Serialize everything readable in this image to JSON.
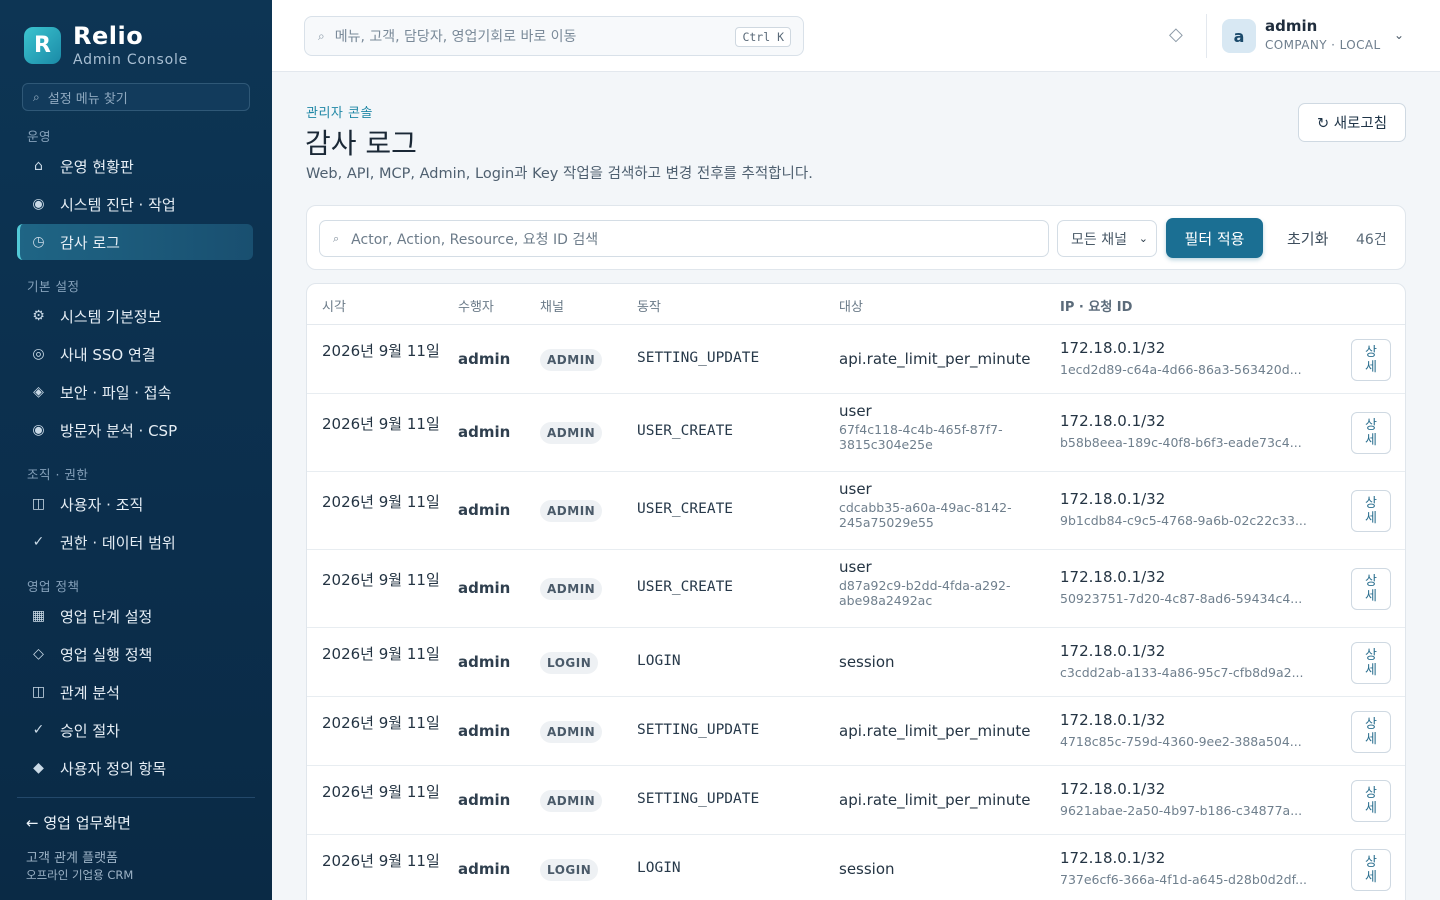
{
  "brand": {
    "logo_letter": "R",
    "name": "Relio",
    "subtitle": "Admin Console"
  },
  "sidebar": {
    "search_placeholder": "설정 메뉴 찾기",
    "groups": [
      "운영",
      "기본 설정",
      "조직 · 권한",
      "영업 정책"
    ],
    "items": [
      {
        "label": "운영 현황판",
        "icon": "home-icon",
        "glyph": "⌂"
      },
      {
        "label": "시스템 진단 · 작업",
        "icon": "diagnostics-icon",
        "glyph": "◉"
      },
      {
        "label": "감사 로그",
        "icon": "clock-icon",
        "glyph": "◷"
      },
      {
        "label": "시스템 기본정보",
        "icon": "gear-icon",
        "glyph": "⚙"
      },
      {
        "label": "사내 SSO 연결",
        "icon": "target-icon",
        "glyph": "◎"
      },
      {
        "label": "보안 · 파일 · 접속",
        "icon": "shield-icon",
        "glyph": "◈"
      },
      {
        "label": "방문자 분석 · CSP",
        "icon": "analytics-icon",
        "glyph": "◉"
      },
      {
        "label": "사용자 · 조직",
        "icon": "users-icon",
        "glyph": "◫"
      },
      {
        "label": "권한 · 데이터 범위",
        "icon": "check-icon",
        "glyph": "✓"
      },
      {
        "label": "영업 단계 설정",
        "icon": "grid-icon",
        "glyph": "▦"
      },
      {
        "label": "영업 실행 정책",
        "icon": "diamond-icon",
        "glyph": "◇"
      },
      {
        "label": "관계 분석",
        "icon": "relation-icon",
        "glyph": "◫"
      },
      {
        "label": "승인 절차",
        "icon": "approval-icon",
        "glyph": "✓"
      },
      {
        "label": "사용자 정의 항목",
        "icon": "custom-field-icon",
        "glyph": "◆"
      }
    ],
    "back_link": "← 영업 업무화면",
    "footer_line1": "고객 관계 플랫폼",
    "footer_line2": "오프라인 기업용 CRM"
  },
  "topbar": {
    "search_placeholder": "메뉴, 고객, 담당자, 영업기회로 바로 이동",
    "shortcut": "Ctrl K",
    "notif_glyph": "◇",
    "avatar_letter": "a",
    "user_name": "admin",
    "user_org": "COMPANY · LOCAL",
    "chevron": "⌄"
  },
  "page": {
    "breadcrumb": "관리자 콘솔",
    "title": "감사 로그",
    "description": "Web, API, MCP, Admin, Login과 Key 작업을 검색하고 변경 전후를 추적합니다.",
    "refresh_label": "↻ 새로고침"
  },
  "filter": {
    "search_placeholder": "Actor, Action, Resource, 요청 ID 검색",
    "channel_value": "모든 채널",
    "apply_label": "필터 적용",
    "reset_label": "초기화",
    "count": "46건"
  },
  "table": {
    "headers": [
      "시각",
      "수행자",
      "채널",
      "동작",
      "대상",
      "IP · 요청 ID"
    ],
    "detail_label": "상세",
    "rows": [
      {
        "time": "2026년 9월 11일",
        "actor": "admin",
        "channel": "ADMIN",
        "action": "SETTING_UPDATE",
        "target": "api.rate_limit_per_minute",
        "target_id": "",
        "ip": "172.18.0.1/32",
        "request_id": "1ecd2d89-c64a-4d66-86a3-563420d..."
      },
      {
        "time": "2026년 9월 11일",
        "actor": "admin",
        "channel": "ADMIN",
        "action": "USER_CREATE",
        "target": "user",
        "target_id": "67f4c118-4c4b-465f-87f7-3815c304e25e",
        "ip": "172.18.0.1/32",
        "request_id": "b58b8eea-189c-40f8-b6f3-eade73c4..."
      },
      {
        "time": "2026년 9월 11일",
        "actor": "admin",
        "channel": "ADMIN",
        "action": "USER_CREATE",
        "target": "user",
        "target_id": "cdcabb35-a60a-49ac-8142-245a75029e55",
        "ip": "172.18.0.1/32",
        "request_id": "9b1cdb84-c9c5-4768-9a6b-02c22c33..."
      },
      {
        "time": "2026년 9월 11일",
        "actor": "admin",
        "channel": "ADMIN",
        "action": "USER_CREATE",
        "target": "user",
        "target_id": "d87a92c9-b2dd-4fda-a292-abe98a2492ac",
        "ip": "172.18.0.1/32",
        "request_id": "50923751-7d20-4c87-8ad6-59434c4..."
      },
      {
        "time": "2026년 9월 11일",
        "actor": "admin",
        "channel": "LOGIN",
        "action": "LOGIN",
        "target": "session",
        "target_id": "",
        "ip": "172.18.0.1/32",
        "request_id": "c3cdd2ab-a133-4a86-95c7-cfb8d9a2..."
      },
      {
        "time": "2026년 9월 11일",
        "actor": "admin",
        "channel": "ADMIN",
        "action": "SETTING_UPDATE",
        "target": "api.rate_limit_per_minute",
        "target_id": "",
        "ip": "172.18.0.1/32",
        "request_id": "4718c85c-759d-4360-9ee2-388a504..."
      },
      {
        "time": "2026년 9월 11일",
        "actor": "admin",
        "channel": "ADMIN",
        "action": "SETTING_UPDATE",
        "target": "api.rate_limit_per_minute",
        "target_id": "",
        "ip": "172.18.0.1/32",
        "request_id": "9621abae-2a50-4b97-b186-c34877a..."
      },
      {
        "time": "2026년 9월 11일",
        "actor": "admin",
        "channel": "LOGIN",
        "action": "LOGIN",
        "target": "session",
        "target_id": "",
        "ip": "172.18.0.1/32",
        "request_id": "737e6cf6-366a-4f1d-a645-d28b0d2df..."
      }
    ]
  }
}
